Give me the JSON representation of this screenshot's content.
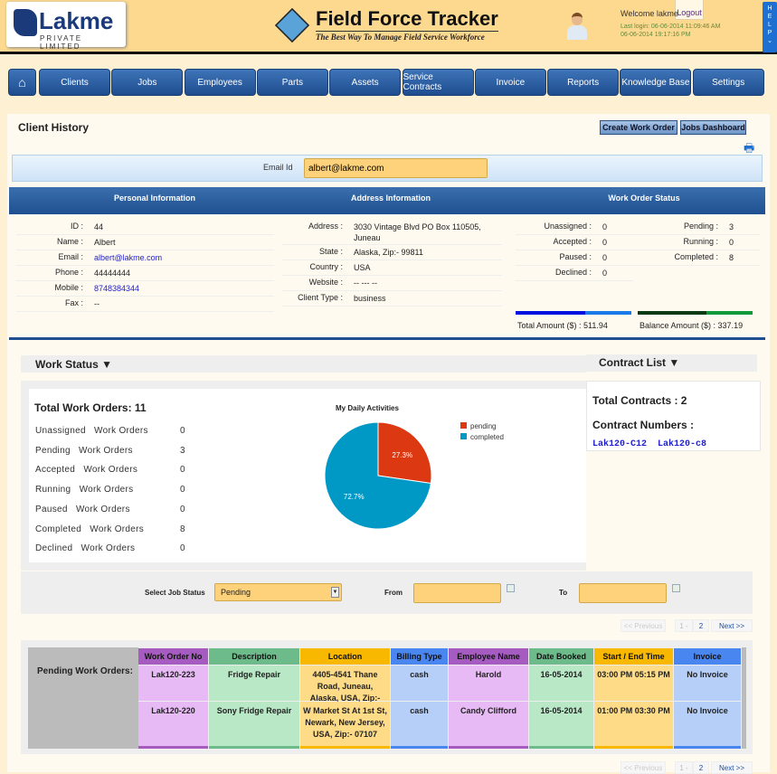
{
  "header": {
    "logo_text": "Lakme",
    "logo_sub": "PRIVATE LIMITED",
    "app_title": "Field Force Tracker",
    "tagline": "The Best Way To Manage Field Service Workforce",
    "welcome": "Welcome lakme",
    "logout": "Logout",
    "last_login": "Last login: 06-06-2014 11:09:46 AM",
    "login_time2": "06-06-2014 19:17:16 PM",
    "help": "HELP"
  },
  "nav": [
    "Clients",
    "Jobs",
    "Employees",
    "Parts",
    "Assets",
    "Service Contracts",
    "Invoice",
    "Reports",
    "Knowledge Base",
    "Settings"
  ],
  "page": {
    "title": "Client History",
    "create_work_order": "Create Work Order",
    "jobs_dashboard": "Jobs Dashboard",
    "email_label": "Email Id",
    "email_value": "albert@lakme.com"
  },
  "sections": {
    "personal": "Personal Information",
    "address": "Address Information",
    "status": "Work Order Status"
  },
  "personal": [
    {
      "k": "ID",
      "v": "44"
    },
    {
      "k": "Name",
      "v": "Albert"
    },
    {
      "k": "Email",
      "v": "albert@lakme.com"
    },
    {
      "k": "Phone",
      "v": "44444444"
    },
    {
      "k": "Mobile",
      "v": "8748384344"
    },
    {
      "k": "Fax",
      "v": "--"
    }
  ],
  "address": [
    {
      "k": "Address",
      "v": "3030 Vintage Blvd PO Box 110505, Juneau"
    },
    {
      "k": "State",
      "v": "Alaska, Zip:- 99811"
    },
    {
      "k": "Country",
      "v": "USA"
    },
    {
      "k": "Website",
      "v": "-- --- --"
    },
    {
      "k": "Client Type",
      "v": "business"
    }
  ],
  "status": {
    "left": [
      {
        "k": "Unassigned",
        "v": "0"
      },
      {
        "k": "Accepted",
        "v": "0"
      },
      {
        "k": "Paused",
        "v": "0"
      },
      {
        "k": "Declined",
        "v": "0"
      }
    ],
    "right": [
      {
        "k": "Pending",
        "v": "3"
      },
      {
        "k": "Running",
        "v": "0"
      },
      {
        "k": "Completed",
        "v": "8"
      }
    ],
    "total_amount": "Total Amount ($) :  511.94",
    "balance_amount": "Balance Amount ($) :  337.19"
  },
  "work_status": {
    "heading": "Work Status ▼",
    "total": "Total Work Orders: 11",
    "rows": [
      {
        "label": "Unassigned   Work Orders",
        "v": "0"
      },
      {
        "label": "Pending   Work Orders",
        "v": "3"
      },
      {
        "label": "Accepted   Work Orders",
        "v": "0"
      },
      {
        "label": "Running   Work Orders",
        "v": "0"
      },
      {
        "label": "Paused   Work Orders",
        "v": "0"
      },
      {
        "label": "Completed   Work Orders",
        "v": "8"
      },
      {
        "label": "Declined   Work Orders",
        "v": "0"
      }
    ]
  },
  "chart_data": {
    "type": "pie",
    "title": "My Daily Activities",
    "legend": "right",
    "slices": [
      {
        "name": "pending",
        "value": 27.3,
        "label": "27.3%",
        "color": "#dc3912"
      },
      {
        "name": "completed",
        "value": 72.7,
        "label": "72.7%",
        "color": "#0099c6"
      }
    ]
  },
  "contracts": {
    "heading": "Contract List ▼",
    "total": "Total Contracts : 2",
    "numbers_label": "Contract Numbers :",
    "numbers": [
      "Lak120-C12",
      "Lak120-c8"
    ]
  },
  "filter": {
    "label": "Select Job Status",
    "selected": "Pending",
    "from": "From",
    "to": "To"
  },
  "pagination": {
    "prev": "<< Previous",
    "p1": "1 -",
    "p2": "2",
    "next": "Next >>"
  },
  "table": {
    "label": "Pending Work Orders:",
    "columns": [
      "Work Order No",
      "Description",
      "Location",
      "Billing Type",
      "Employee Name",
      "Date Booked",
      "Start / End Time",
      "Invoice"
    ],
    "rows": [
      [
        "Lak120-223",
        "Fridge Repair",
        "4405-4541 Thane Road, Juneau, Alaska, USA, Zip:- 99801",
        "cash",
        "Harold",
        "16-05-2014",
        "03:00 PM 05:15 PM",
        "No Invoice"
      ],
      [
        "Lak120-220",
        "Sony Fridge Repair",
        "W Market St At 1st St, Newark, New Jersey, USA, Zip:- 07107",
        "cash",
        "Candy Clifford",
        "16-05-2014",
        "01:00 PM 03:30 PM",
        "No Invoice"
      ]
    ]
  }
}
